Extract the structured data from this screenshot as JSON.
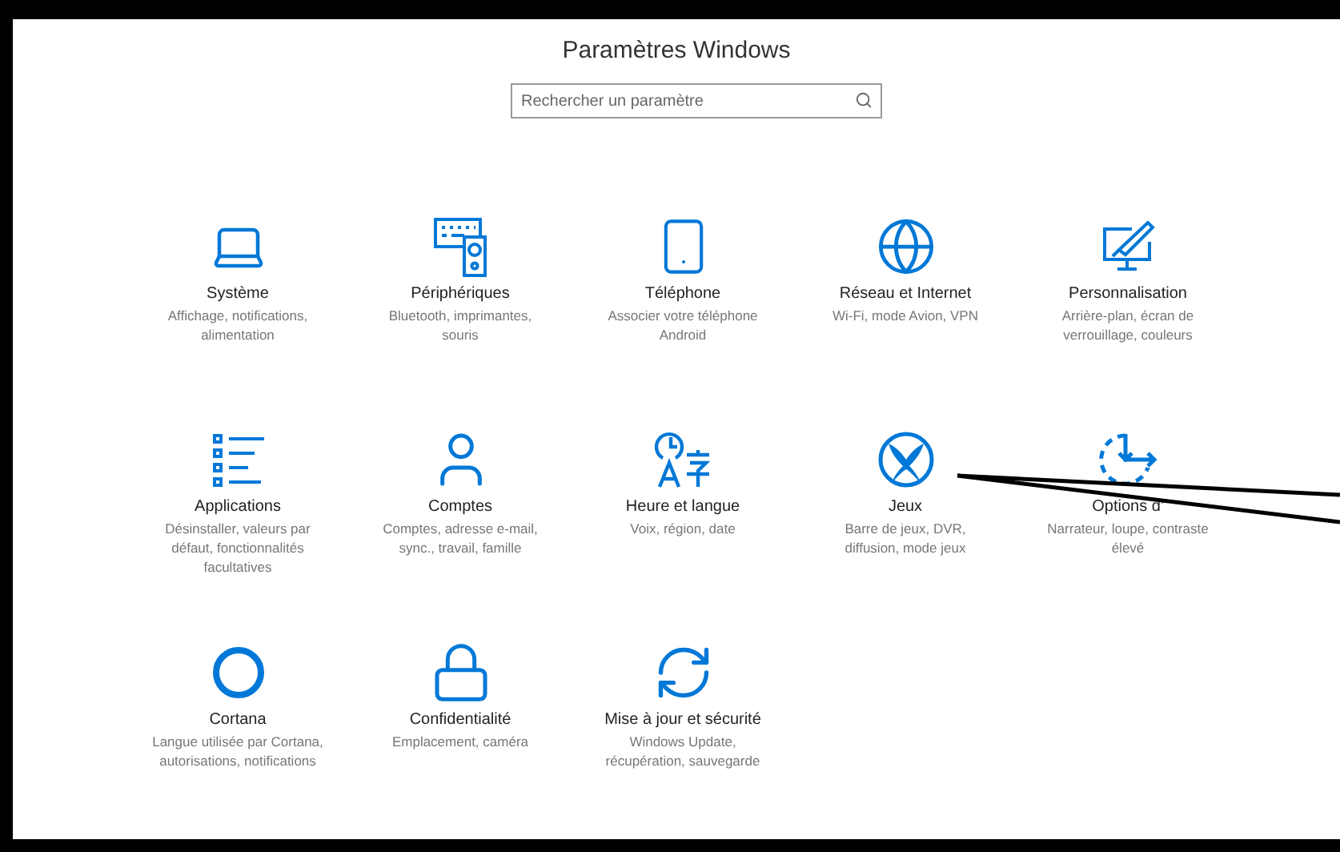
{
  "window": {
    "title": "Paramètres Windows"
  },
  "search": {
    "placeholder": "Rechercher un paramètre"
  },
  "categories": [
    {
      "name": "Système",
      "description": "Affichage, notifications,\nalimentation"
    },
    {
      "name": "Périphériques",
      "description": "Bluetooth, imprimantes,\nsouris"
    },
    {
      "name": "Téléphone",
      "description": "Associer votre téléphone\nAndroid"
    },
    {
      "name": "Réseau et Internet",
      "description": "Wi-Fi, mode Avion, VPN"
    },
    {
      "name": "Personnalisation",
      "description": "Arrière-plan, écran de\nverrouillage, couleurs"
    },
    {
      "name": "Applications",
      "description": "Désinstaller, valeurs par\ndéfaut, fonctionnalités\nfacultatives"
    },
    {
      "name": "Comptes",
      "description": "Comptes, adresse e-mail,\nsync., travail, famille"
    },
    {
      "name": "Heure et langue",
      "description": "Voix, région, date"
    },
    {
      "name": "Jeux",
      "description": "Barre de jeux, DVR,\ndiffusion, mode jeux"
    },
    {
      "name": "Options d'",
      "description": "Narrateur, loupe, contraste\nélevé"
    },
    {
      "name": "Cortana",
      "description": "Langue utilisée par Cortana,\nautorisations, notifications"
    },
    {
      "name": "Confidentialité",
      "description": "Emplacement, caméra"
    },
    {
      "name": "Mise à jour et sécurité",
      "description": "Windows Update,\nrécupération, sauvegarde"
    }
  ]
}
